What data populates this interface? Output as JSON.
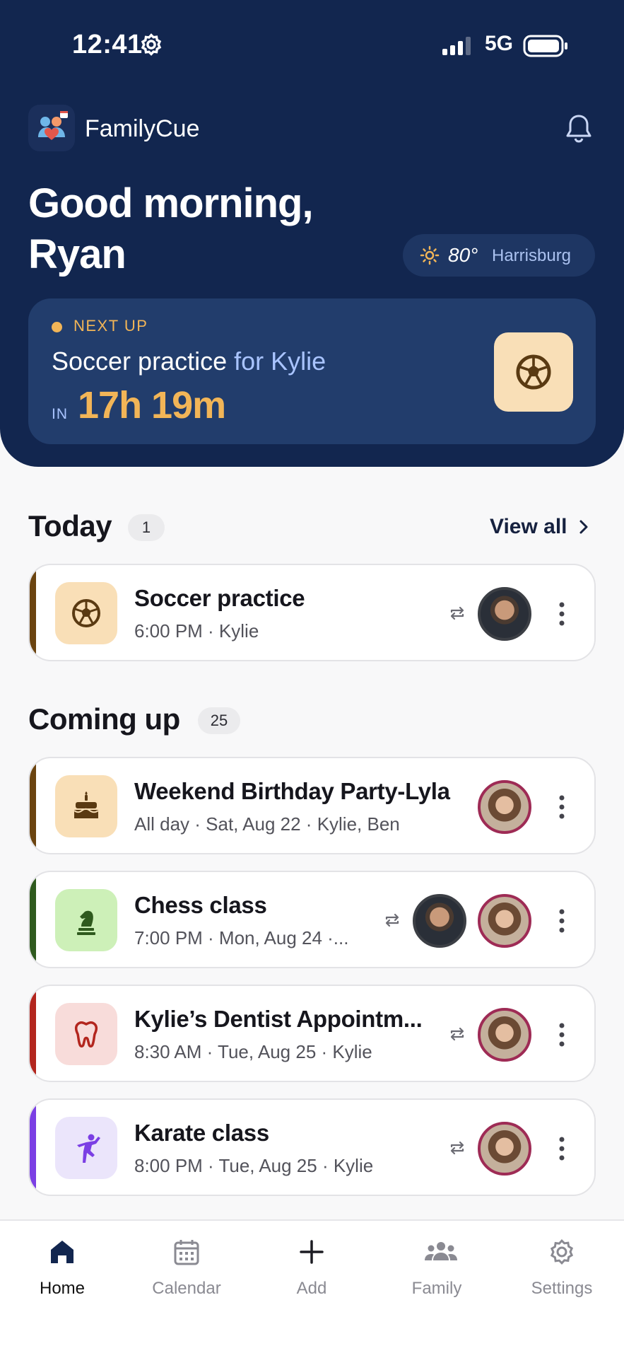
{
  "status_bar": {
    "time": "12:41",
    "network": "5G"
  },
  "app": {
    "name": "FamilyCue"
  },
  "greeting": {
    "line1": "Good morning,",
    "line2": "Ryan"
  },
  "weather": {
    "temp": "80°",
    "city": "Harrisburg"
  },
  "next_up": {
    "label": "NEXT UP",
    "event": "Soccer practice",
    "for_text": "for Kylie",
    "in_label": "IN",
    "countdown": "17h 19m",
    "icon": "soccer-ball-icon"
  },
  "today": {
    "title": "Today",
    "count": "1",
    "view_all": "View all",
    "events": [
      {
        "title": "Soccer practice",
        "subtitle": "6:00 PM · Kylie",
        "icon": "soccer-ball-icon",
        "color": "#6b4410",
        "bg": "#f9dfb7",
        "recurring": true,
        "avatars": [
          "ryan"
        ]
      }
    ]
  },
  "coming_up": {
    "title": "Coming up",
    "count": "25",
    "events": [
      {
        "title": "Weekend Birthday Party-Lyla",
        "subtitle": "All day · Sat, Aug 22 · Kylie, Ben",
        "icon": "cake-icon",
        "color": "#6b4410",
        "bg": "#f9dfb7",
        "recurring": false,
        "avatars": [
          "kylie"
        ]
      },
      {
        "title": "Chess class",
        "subtitle": "7:00 PM · Mon, Aug 24 ·...",
        "icon": "chess-knight-icon",
        "color": "#2f5a1e",
        "bg": "#cdf0b8",
        "recurring": true,
        "avatars": [
          "ryan",
          "kylie"
        ]
      },
      {
        "title": "Kylie’s Dentist Appointm...",
        "subtitle": "8:30 AM · Tue, Aug 25 · Kylie",
        "icon": "tooth-icon",
        "color": "#b3261e",
        "bg": "#f8dcda",
        "recurring": true,
        "avatars": [
          "kylie"
        ]
      },
      {
        "title": "Karate class",
        "subtitle": "8:00 PM · Tue, Aug 25 · Kylie",
        "icon": "karate-icon",
        "color": "#7b3fe4",
        "bg": "#ebe5fb",
        "recurring": true,
        "avatars": [
          "kylie"
        ]
      }
    ]
  },
  "tabs": [
    {
      "label": "Home",
      "icon": "home-icon",
      "active": true
    },
    {
      "label": "Calendar",
      "icon": "calendar-icon",
      "active": false
    },
    {
      "label": "Add",
      "icon": "plus-icon",
      "active": false
    },
    {
      "label": "Family",
      "icon": "family-icon",
      "active": false
    },
    {
      "label": "Settings",
      "icon": "settings-icon",
      "active": false
    }
  ]
}
